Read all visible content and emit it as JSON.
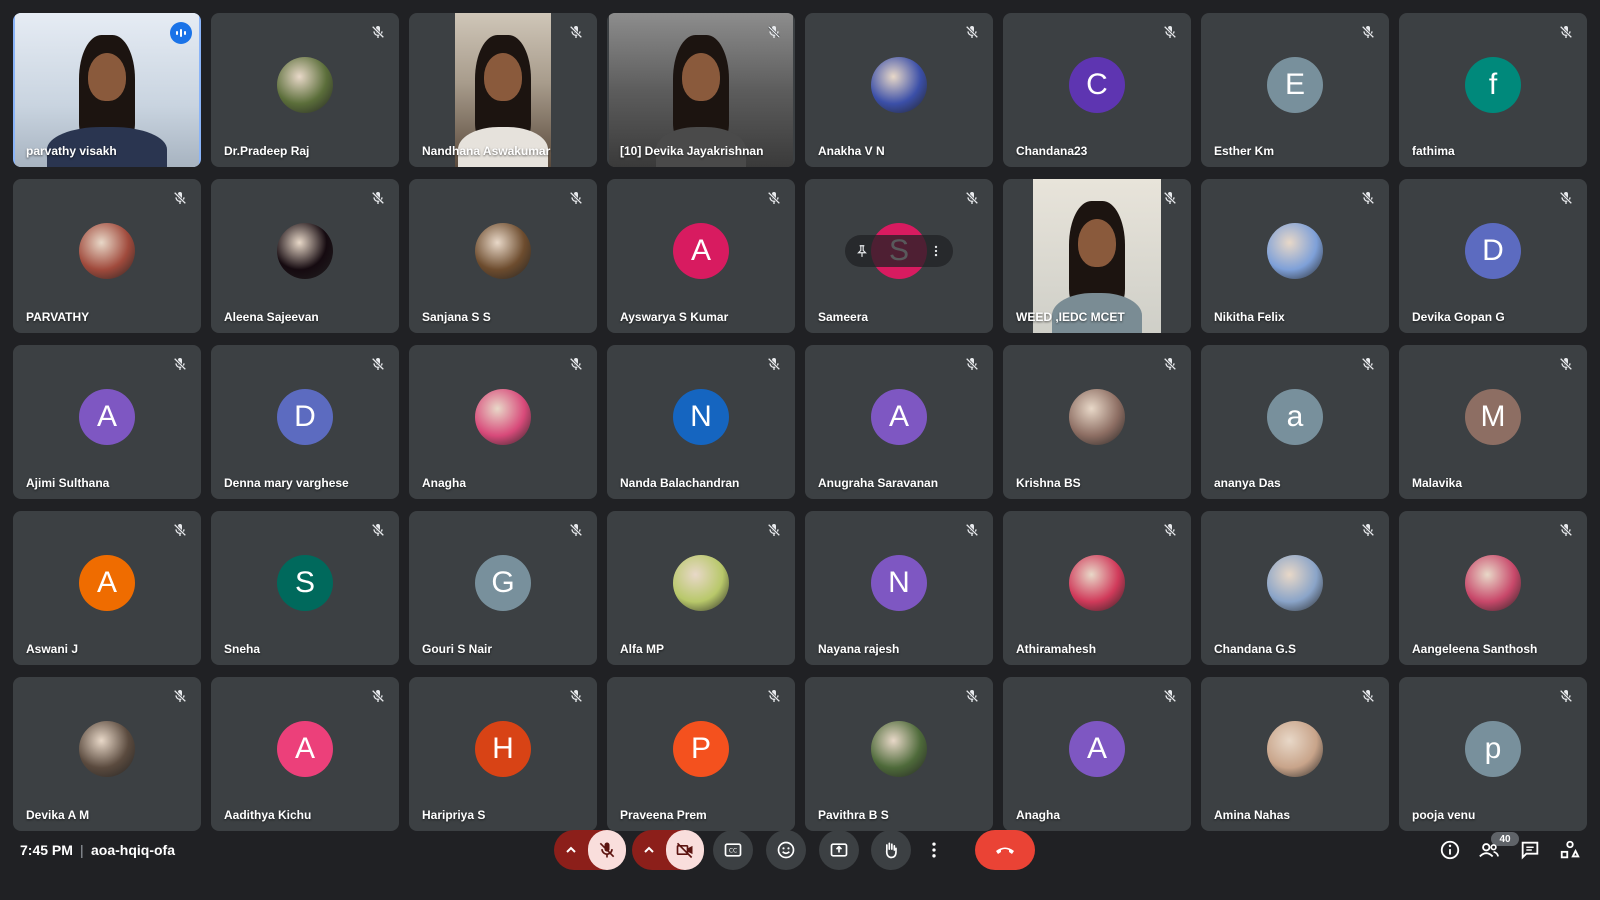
{
  "meeting": {
    "time": "7:45 PM",
    "separator": "|",
    "code": "aoa-hqiq-ofa",
    "participant_count": "40"
  },
  "colors": {
    "background": "#202124",
    "tile": "#3c4043",
    "speaking_outline": "#8ab4f8",
    "end_call": "#ea4335",
    "muted_control": "#f9dedc"
  },
  "participants": [
    {
      "name": "parvathy visakh",
      "type": "video",
      "speaking": true
    },
    {
      "name": "Dr.Pradeep Raj",
      "type": "photo",
      "color": "#5b6e3a"
    },
    {
      "name": "Nandhana Aswakumar",
      "type": "video"
    },
    {
      "name": "[10] Devika Jayakrishnan",
      "type": "video_wide"
    },
    {
      "name": "Anakha V N",
      "type": "photo",
      "color": "#3b4fa8"
    },
    {
      "name": "Chandana23",
      "type": "letter",
      "letter": "C",
      "color": "#5e35b1"
    },
    {
      "name": "Esther Km",
      "type": "letter",
      "letter": "E",
      "color": "#78909c"
    },
    {
      "name": "fathima",
      "type": "letter",
      "letter": "f",
      "color": "#00897b"
    },
    {
      "name": "PARVATHY",
      "type": "photo",
      "color": "#a04a3c"
    },
    {
      "name": "Aleena Sajeevan",
      "type": "photo",
      "color": "#150a10"
    },
    {
      "name": "Sanjana S S",
      "type": "photo",
      "color": "#6d4c2e"
    },
    {
      "name": "Ayswarya S Kumar",
      "type": "letter",
      "letter": "A",
      "color": "#d81b60"
    },
    {
      "name": "Sameera",
      "type": "letter_hover",
      "letter": "S",
      "color": "#d81b60"
    },
    {
      "name": "WEED ,IEDC MCET",
      "type": "video_green"
    },
    {
      "name": "Nikitha Felix",
      "type": "photo",
      "color": "#7ea0d8"
    },
    {
      "name": "Devika Gopan G",
      "type": "letter",
      "letter": "D",
      "color": "#5c6bc0"
    },
    {
      "name": "Ajimi Sulthana",
      "type": "letter",
      "letter": "A",
      "color": "#7e57c2"
    },
    {
      "name": "Denna mary varghese",
      "type": "letter",
      "letter": "D",
      "color": "#5c6bc0"
    },
    {
      "name": "Anagha",
      "type": "photo",
      "color": "#d84a7a"
    },
    {
      "name": "Nanda Balachandran",
      "type": "letter",
      "letter": "N",
      "color": "#1565c0"
    },
    {
      "name": "Anugraha Saravanan",
      "type": "letter",
      "letter": "A",
      "color": "#7e57c2"
    },
    {
      "name": "Krishna BS",
      "type": "photo",
      "color": "#8d6e63"
    },
    {
      "name": "ananya Das",
      "type": "letter",
      "letter": "a",
      "color": "#78909c"
    },
    {
      "name": "Malavika",
      "type": "letter",
      "letter": "M",
      "color": "#8d6e63"
    },
    {
      "name": "Aswani J",
      "type": "letter",
      "letter": "A",
      "color": "#ef6c00"
    },
    {
      "name": "Sneha",
      "type": "letter",
      "letter": "S",
      "color": "#00695c"
    },
    {
      "name": "Gouri S Nair",
      "type": "letter",
      "letter": "G",
      "color": "#78909c"
    },
    {
      "name": "Alfa MP",
      "type": "photo",
      "color": "#b8c86a"
    },
    {
      "name": "Nayana rajesh",
      "type": "letter",
      "letter": "N",
      "color": "#7e57c2"
    },
    {
      "name": "Athiramahesh",
      "type": "photo",
      "color": "#d03a5a"
    },
    {
      "name": "Chandana G.S",
      "type": "photo",
      "color": "#8aa4c8"
    },
    {
      "name": "Aangeleena Santhosh",
      "type": "photo",
      "color": "#c8486a"
    },
    {
      "name": "Devika A M",
      "type": "photo",
      "color": "#5a4a3e"
    },
    {
      "name": "Aadithya Kichu",
      "type": "letter",
      "letter": "A",
      "color": "#ec407a"
    },
    {
      "name": "Haripriya S",
      "type": "letter",
      "letter": "H",
      "color": "#d84315"
    },
    {
      "name": "Praveena Prem",
      "type": "letter",
      "letter": "P",
      "color": "#f4511e"
    },
    {
      "name": "Pavithra B S",
      "type": "photo",
      "color": "#4e6a3a"
    },
    {
      "name": "Anagha",
      "type": "letter",
      "letter": "A",
      "color": "#7e57c2"
    },
    {
      "name": "Amina Nahas",
      "type": "photo",
      "color": "#c8a48a"
    },
    {
      "name": "pooja venu",
      "type": "letter",
      "letter": "p",
      "color": "#78909c"
    }
  ],
  "icons": {
    "mic": "mic-off-icon",
    "camera": "camera-off-icon",
    "captions": "captions-icon",
    "emoji": "emoji-icon",
    "present": "present-icon",
    "hand": "raise-hand-icon",
    "more": "more-options-icon",
    "end": "end-call-icon",
    "info": "info-icon",
    "people": "people-icon",
    "chat": "chat-icon",
    "activities": "activities-icon"
  }
}
